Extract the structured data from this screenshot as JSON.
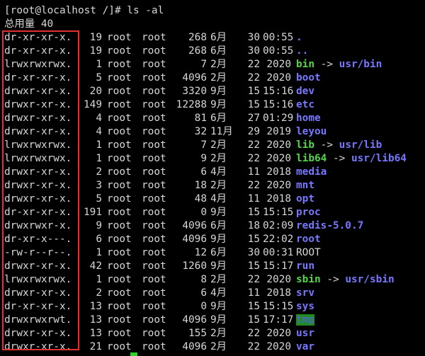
{
  "terminal": {
    "prompt": "[root@localhost /]# ls -al",
    "total": "总用量 40"
  },
  "colors": {
    "background": "#000000",
    "text": "#d7d7d7",
    "directory": "#7878ff",
    "symlink": "#55d64a",
    "sticky_bg": "#1e8c1e",
    "highlight_border": "#e03030"
  },
  "entries": [
    {
      "perm": "dr-xr-xr-x.",
      "links": "19",
      "owner": "root",
      "group": "root",
      "size": "268",
      "month": "6月",
      "day": "30",
      "time": "00:55",
      "name": ".",
      "type": "dir",
      "target": ""
    },
    {
      "perm": "dr-xr-xr-x.",
      "links": "19",
      "owner": "root",
      "group": "root",
      "size": "268",
      "month": "6月",
      "day": "30",
      "time": "00:55",
      "name": "..",
      "type": "dir",
      "target": ""
    },
    {
      "perm": "lrwxrwxrwx.",
      "links": "1",
      "owner": "root",
      "group": "root",
      "size": "7",
      "month": "2月",
      "day": "22",
      "time": "2020",
      "name": "bin",
      "type": "link",
      "target": "usr/bin"
    },
    {
      "perm": "dr-xr-xr-x.",
      "links": "5",
      "owner": "root",
      "group": "root",
      "size": "4096",
      "month": "2月",
      "day": "22",
      "time": "2020",
      "name": "boot",
      "type": "dir",
      "target": ""
    },
    {
      "perm": "drwxr-xr-x.",
      "links": "20",
      "owner": "root",
      "group": "root",
      "size": "3320",
      "month": "9月",
      "day": "15",
      "time": "15:16",
      "name": "dev",
      "type": "dir",
      "target": ""
    },
    {
      "perm": "drwxr-xr-x.",
      "links": "149",
      "owner": "root",
      "group": "root",
      "size": "12288",
      "month": "9月",
      "day": "15",
      "time": "15:16",
      "name": "etc",
      "type": "dir",
      "target": ""
    },
    {
      "perm": "drwxr-xr-x.",
      "links": "4",
      "owner": "root",
      "group": "root",
      "size": "81",
      "month": "6月",
      "day": "27",
      "time": "01:29",
      "name": "home",
      "type": "dir",
      "target": ""
    },
    {
      "perm": "drwxr-xr-x.",
      "links": "4",
      "owner": "root",
      "group": "root",
      "size": "32",
      "month": "11月",
      "day": "29",
      "time": "2019",
      "name": "leyou",
      "type": "dir",
      "target": ""
    },
    {
      "perm": "lrwxrwxrwx.",
      "links": "1",
      "owner": "root",
      "group": "root",
      "size": "7",
      "month": "2月",
      "day": "22",
      "time": "2020",
      "name": "lib",
      "type": "link",
      "target": "usr/lib"
    },
    {
      "perm": "lrwxrwxrwx.",
      "links": "1",
      "owner": "root",
      "group": "root",
      "size": "9",
      "month": "2月",
      "day": "22",
      "time": "2020",
      "name": "lib64",
      "type": "link",
      "target": "usr/lib64"
    },
    {
      "perm": "drwxr-xr-x.",
      "links": "2",
      "owner": "root",
      "group": "root",
      "size": "6",
      "month": "4月",
      "day": "11",
      "time": "2018",
      "name": "media",
      "type": "dir",
      "target": ""
    },
    {
      "perm": "drwxr-xr-x.",
      "links": "3",
      "owner": "root",
      "group": "root",
      "size": "18",
      "month": "2月",
      "day": "22",
      "time": "2020",
      "name": "mnt",
      "type": "dir",
      "target": ""
    },
    {
      "perm": "drwxr-xr-x.",
      "links": "5",
      "owner": "root",
      "group": "root",
      "size": "48",
      "month": "4月",
      "day": "11",
      "time": "2018",
      "name": "opt",
      "type": "dir",
      "target": ""
    },
    {
      "perm": "dr-xr-xr-x.",
      "links": "191",
      "owner": "root",
      "group": "root",
      "size": "0",
      "month": "9月",
      "day": "15",
      "time": "15:15",
      "name": "proc",
      "type": "dir",
      "target": ""
    },
    {
      "perm": "drwxrwxr-x.",
      "links": "9",
      "owner": "root",
      "group": "root",
      "size": "4096",
      "month": "6月",
      "day": "18",
      "time": "02:09",
      "name": "redis-5.0.7",
      "type": "dir",
      "target": ""
    },
    {
      "perm": "dr-xr-x---.",
      "links": "6",
      "owner": "root",
      "group": "root",
      "size": "4096",
      "month": "9月",
      "day": "15",
      "time": "22:02",
      "name": "root",
      "type": "dir",
      "target": ""
    },
    {
      "perm": "-rw-r--r--.",
      "links": "1",
      "owner": "root",
      "group": "root",
      "size": "12",
      "month": "6月",
      "day": "30",
      "time": "00:31",
      "name": "ROOT",
      "type": "file",
      "target": ""
    },
    {
      "perm": "drwxr-xr-x.",
      "links": "42",
      "owner": "root",
      "group": "root",
      "size": "1260",
      "month": "9月",
      "day": "15",
      "time": "15:17",
      "name": "run",
      "type": "dir",
      "target": ""
    },
    {
      "perm": "lrwxrwxrwx.",
      "links": "1",
      "owner": "root",
      "group": "root",
      "size": "8",
      "month": "2月",
      "day": "22",
      "time": "2020",
      "name": "sbin",
      "type": "link",
      "target": "usr/sbin"
    },
    {
      "perm": "drwxr-xr-x.",
      "links": "2",
      "owner": "root",
      "group": "root",
      "size": "6",
      "month": "4月",
      "day": "11",
      "time": "2018",
      "name": "srv",
      "type": "dir",
      "target": ""
    },
    {
      "perm": "dr-xr-xr-x.",
      "links": "13",
      "owner": "root",
      "group": "root",
      "size": "0",
      "month": "9月",
      "day": "15",
      "time": "15:15",
      "name": "sys",
      "type": "dir",
      "target": ""
    },
    {
      "perm": "drwxrwxrwt.",
      "links": "13",
      "owner": "root",
      "group": "root",
      "size": "4096",
      "month": "9月",
      "day": "15",
      "time": "17:17",
      "name": "tmp",
      "type": "sticky",
      "target": ""
    },
    {
      "perm": "drwxr-xr-x.",
      "links": "13",
      "owner": "root",
      "group": "root",
      "size": "155",
      "month": "2月",
      "day": "22",
      "time": "2020",
      "name": "usr",
      "type": "dir",
      "target": ""
    },
    {
      "perm": "drwxr-xr-x.",
      "links": "21",
      "owner": "root",
      "group": "root",
      "size": "4096",
      "month": "2月",
      "day": "22",
      "time": "2020",
      "name": "var",
      "type": "dir",
      "target": ""
    }
  ]
}
